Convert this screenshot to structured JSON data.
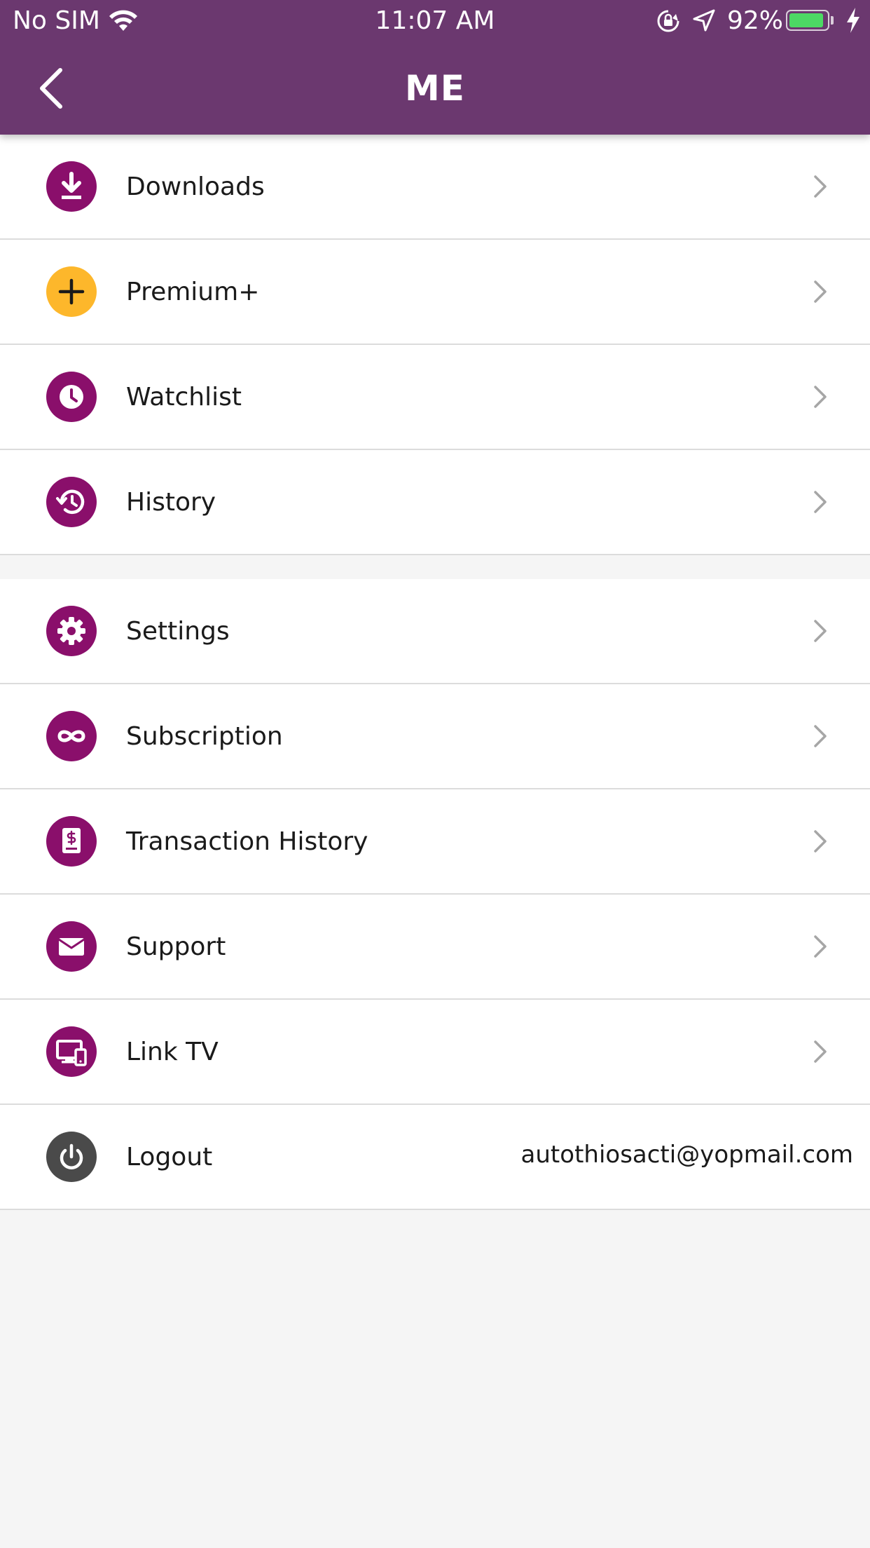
{
  "status_bar": {
    "carrier": "No SIM",
    "time": "11:07 AM",
    "battery_percent_text": "92%",
    "battery_level": 0.92,
    "battery_color": "#4cd964",
    "icons": [
      "wifi-icon",
      "orientation-lock-icon",
      "location-arrow-icon",
      "battery-icon",
      "charging-bolt-icon"
    ]
  },
  "header": {
    "title": "ME",
    "background_color": "#6b386f",
    "back_icon": "chevron-left-icon"
  },
  "menu": {
    "group_1": [
      {
        "label": "Downloads",
        "icon": "download-icon",
        "icon_color": "#8a0f6b"
      },
      {
        "label": "Premium+",
        "icon": "plus-icon",
        "icon_color": "#fdb72b"
      },
      {
        "label": "Watchlist",
        "icon": "clock-icon",
        "icon_color": "#8a0f6b"
      },
      {
        "label": "History",
        "icon": "history-icon",
        "icon_color": "#8a0f6b"
      }
    ],
    "group_2": [
      {
        "label": "Settings",
        "icon": "gear-icon",
        "icon_color": "#8a0f6b"
      },
      {
        "label": "Subscription",
        "icon": "infinity-icon",
        "icon_color": "#8a0f6b"
      },
      {
        "label": "Transaction History",
        "icon": "receipt-dollar-icon",
        "icon_color": "#8a0f6b"
      },
      {
        "label": "Support",
        "icon": "envelope-icon",
        "icon_color": "#8a0f6b"
      },
      {
        "label": "Link TV",
        "icon": "devices-icon",
        "icon_color": "#8a0f6b"
      },
      {
        "label": "Logout",
        "icon": "power-icon",
        "icon_color": "#4a4a4a",
        "value": "autothiosacti@yopmail.com"
      }
    ]
  }
}
